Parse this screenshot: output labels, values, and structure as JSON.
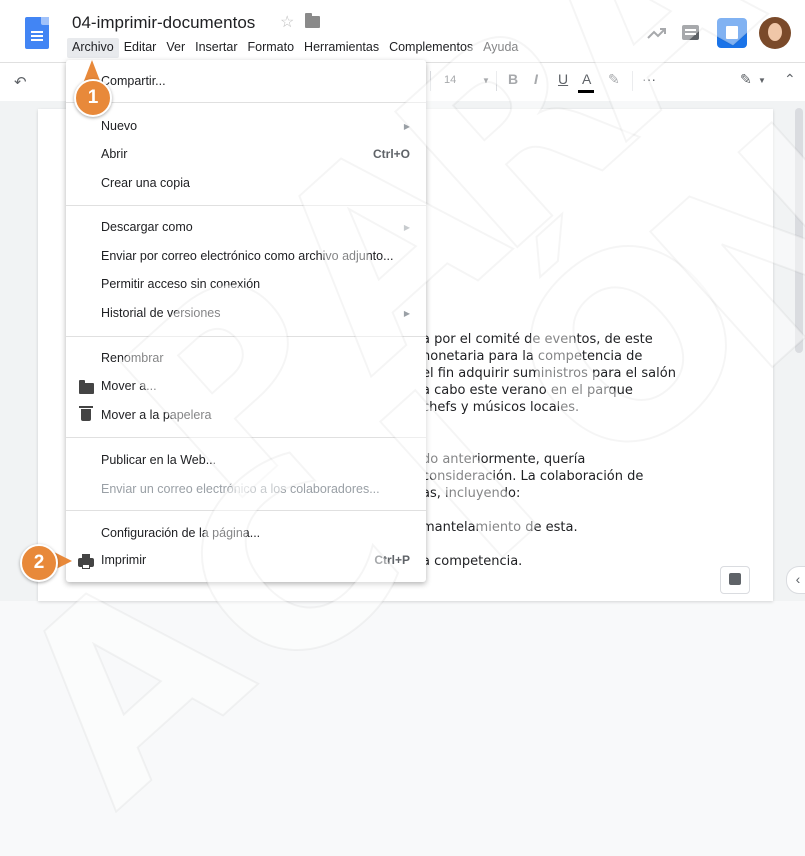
{
  "window": {
    "doc_title": "04-imprimir-documentos",
    "star_icon": "star-icon",
    "folder_icon": "folder-icon"
  },
  "menubar": {
    "items": [
      "Archivo",
      "Editar",
      "Ver",
      "Insertar",
      "Formato",
      "Herramientas",
      "Complementos",
      "Ayuda"
    ],
    "active": "Archivo"
  },
  "header_icons": [
    "trend-icon",
    "comment-icon",
    "share-icon",
    "avatar"
  ],
  "toolbar": {
    "font_size": "14",
    "bold": "B",
    "italic": "I",
    "underline": "U",
    "text_color": "A",
    "more": "···"
  },
  "file_menu": {
    "share": "Compartir...",
    "new": "Nuevo",
    "open": "Abrir",
    "open_shortcut": "Ctrl+O",
    "copy": "Crear una copia",
    "download": "Descargar como",
    "email_attachment": "Enviar por correo electrónico como archivo adjunto...",
    "offline": "Permitir acceso sin conexión",
    "history": "Historial de versiones",
    "rename": "Renombrar",
    "move": "Mover a...",
    "trash": "Mover a la papelera",
    "publish": "Publicar en la Web...",
    "email_collab": "Enviar un correo electrónico a los colaboradores...",
    "page_setup": "Configuración de la página...",
    "print": "Imprimir",
    "print_shortcut": "Ctrl+P"
  },
  "document_lines": [
    "a por el comité de eventos, de este",
    "nonetaria para la competencia de",
    "el fin adquirir suministros para el salón",
    "a cabo este verano en el parque",
    " chefs y músicos locales.",
    "do anteriormente, quería",
    " consideración. La colaboración de",
    "as, incluyendo:",
    "mantelamiento de esta.",
    "a competencia."
  ],
  "callouts": [
    "1",
    "2"
  ],
  "watermark": [
    "P",
    "A",
    "R",
    "A",
    "A",
    "C",
    "I",
    "Ó",
    "N"
  ],
  "accent_colors": {
    "callout": "#e8893a",
    "docs_blue": "#4285f4",
    "share_blue": "#1a73e8"
  }
}
